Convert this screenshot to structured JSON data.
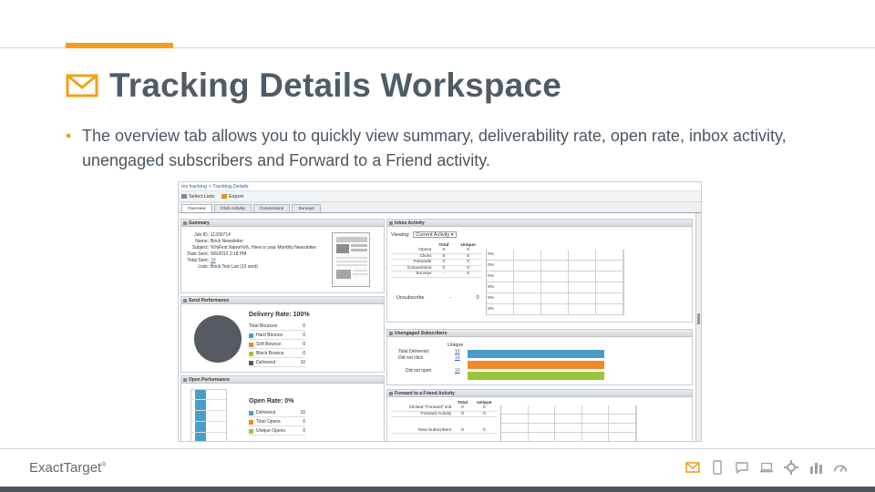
{
  "slide": {
    "title": "Tracking Details Workspace",
    "bullet": "The overview  tab allows you to quickly view summary, deliverability rate, open rate, inbox activity, unengaged subscribers and Forward to a Friend activity.",
    "brand": "ExactTarget",
    "brand_mark": "®",
    "colors": {
      "accent": "#f2a118",
      "title": "#4e5c66",
      "text": "#4a5660"
    },
    "footer_icons": [
      "envelope-icon",
      "phone-icon",
      "chat-icon",
      "laptop-icon",
      "gear-icon",
      "bar-chart-icon",
      "gauge-icon"
    ]
  },
  "app": {
    "breadcrumb": "my tracking > Tracking Details",
    "toolbar": {
      "select_lists": "Select Lists",
      "export": "Export"
    },
    "tabs": [
      "Overview",
      "Click Activity",
      "Conversions",
      "Surveys"
    ],
    "summary": {
      "header": "Summary",
      "job_id_label": "Job ID:",
      "job_id": "11330714",
      "name_label": "Name:",
      "name": "Brick Newsletter",
      "subject_label": "Subject:",
      "subject": "%%First Name%%, Here is your Monthly Newsletter",
      "date_sent_label": "Date Sent:",
      "date_sent": "5/6/2012 2:18 PM",
      "total_sent_label": "Total Sent:",
      "total_sent": "10",
      "lists_label": "Lists:",
      "lists": "Brick Test List (10 sent)"
    },
    "send_performance": {
      "header": "Send Performance",
      "rate": "Delivery Rate: 100%",
      "rows": [
        {
          "label": "Total Bounces",
          "value": "0",
          "color": ""
        },
        {
          "label": "Hard Bounce",
          "value": "0",
          "color": "#4a9cc9"
        },
        {
          "label": "Soft Bounce",
          "value": "0",
          "color": "#ef8a2a"
        },
        {
          "label": "Block Bounce",
          "value": "0",
          "color": "#9cc33a"
        },
        {
          "label": "Delivered",
          "value": "10",
          "color": "#555b60"
        }
      ]
    },
    "open_performance": {
      "header": "Open Performance",
      "rate": "Open Rate: 0%",
      "rows": [
        {
          "label": "Delivered",
          "value": "10",
          "color": "#4a9cc9"
        },
        {
          "label": "Total Opens",
          "value": "0",
          "color": "#ef8a2a"
        },
        {
          "label": "Unique Opens",
          "value": "0",
          "color": "#9cc33a"
        }
      ]
    },
    "inbox_activity": {
      "header": "Inbox Activity",
      "viewing_label": "Viewing:",
      "viewing_value": "Current Activity",
      "col_total": "Total",
      "col_unique": "Unique",
      "rows": [
        {
          "label": "Opens",
          "total": "0",
          "unique": "0"
        },
        {
          "label": "Clicks",
          "total": "0",
          "unique": "0"
        },
        {
          "label": "Forwards",
          "total": "0",
          "unique": "0"
        },
        {
          "label": "Conversions",
          "total": "0",
          "unique": "0"
        },
        {
          "label": "Surveys",
          "total": "-",
          "unique": "0"
        }
      ],
      "unsub_label": "Unsubscribe",
      "unsub_total": "-",
      "unsub_unique": "0",
      "pct_labels": [
        "0%",
        "0%",
        "0%",
        "0%",
        "0%",
        "0%"
      ]
    },
    "unengaged": {
      "header": "Unengaged Subscribers",
      "col_unique": "Unique",
      "rows": [
        {
          "label": "Total Delivered",
          "value": "10",
          "color": "#4a9cc9"
        },
        {
          "label": "Did not click",
          "value": "10",
          "color": "#ef8a2a"
        },
        {
          "label": "Did not open",
          "value": "10",
          "color": "#9cc33a"
        }
      ]
    },
    "forward": {
      "header": "Forward to a Friend Activity",
      "col_total": "Total",
      "col_unique": "Unique",
      "rows": [
        {
          "label": "Clicked \"Forward\" link",
          "total": "0",
          "unique": "0"
        },
        {
          "label": "Forward Activity",
          "total": "0",
          "unique": "0"
        },
        {
          "label": "New Subscribers",
          "total": "0",
          "unique": "0"
        }
      ]
    }
  }
}
